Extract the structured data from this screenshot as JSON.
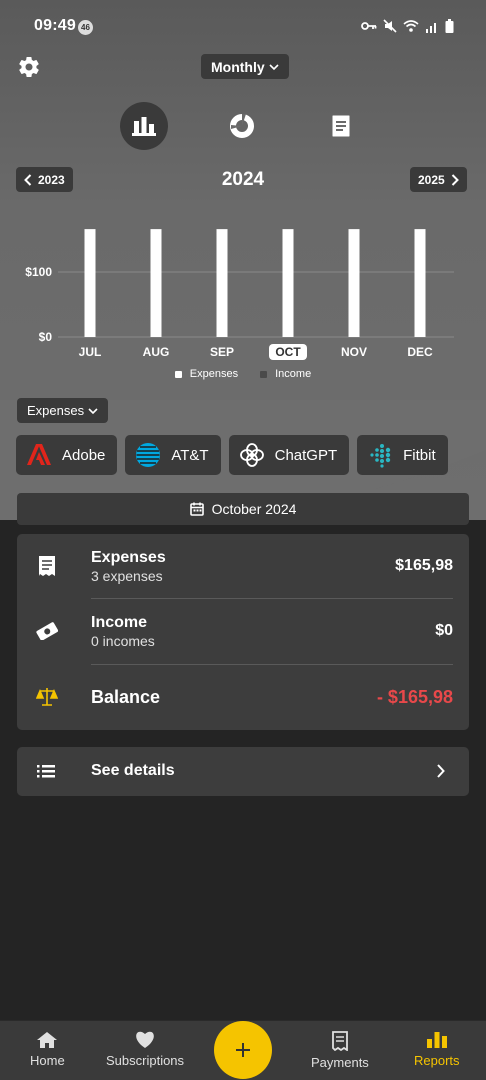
{
  "status_bar": {
    "time": "09:49",
    "badge": "46"
  },
  "header": {
    "period_label": "Monthly"
  },
  "year_nav": {
    "prev": "2023",
    "current": "2024",
    "next": "2025"
  },
  "chart_data": {
    "type": "bar",
    "categories": [
      "JUL",
      "AUG",
      "SEP",
      "OCT",
      "NOV",
      "DEC"
    ],
    "series": [
      {
        "name": "Expenses",
        "values": [
          165.98,
          165.98,
          165.98,
          165.98,
          165.98,
          165.98
        ]
      },
      {
        "name": "Income",
        "values": [
          0,
          0,
          0,
          0,
          0,
          0
        ]
      }
    ],
    "y_ticks": [
      "$0",
      "$100"
    ],
    "ylim": [
      0,
      180
    ],
    "selected_category": "OCT",
    "colors": {
      "expenses": "#ffffff",
      "income": "#4a4a4a",
      "grid": "#8a8a8a"
    }
  },
  "legend": {
    "expenses": "Expenses",
    "income": "Income"
  },
  "type_filter": {
    "label": "Expenses"
  },
  "services": [
    {
      "name": "Adobe",
      "icon": "adobe-icon"
    },
    {
      "name": "AT&T",
      "icon": "att-icon"
    },
    {
      "name": "ChatGPT",
      "icon": "chatgpt-icon"
    },
    {
      "name": "Fitbit",
      "icon": "fitbit-icon"
    }
  ],
  "month_header": {
    "label": "October 2024"
  },
  "summary": {
    "expenses": {
      "title": "Expenses",
      "sub": "3 expenses",
      "value": "$165,98"
    },
    "income": {
      "title": "Income",
      "sub": "0 incomes",
      "value": "$0"
    },
    "balance": {
      "title": "Balance",
      "value": "- $165,98",
      "color": "#e8484a"
    }
  },
  "details": {
    "label": "See details"
  },
  "nav": {
    "home": "Home",
    "subscriptions": "Subscriptions",
    "payments": "Payments",
    "reports": "Reports",
    "active_color": "#f5c400"
  }
}
